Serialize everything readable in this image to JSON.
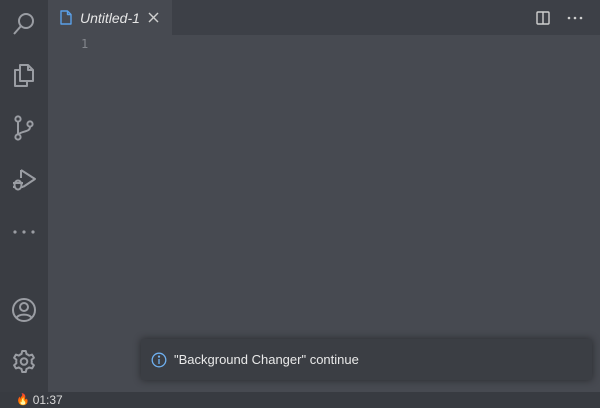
{
  "activity_bar": {
    "icons": [
      "search-icon",
      "explorer-icon",
      "source-control-icon",
      "run-debug-icon",
      "more-icon",
      "account-icon",
      "settings-icon"
    ]
  },
  "tab": {
    "label": "Untitled-1",
    "file_icon": "file-icon",
    "close_icon": "close-icon"
  },
  "tab_actions": {
    "icons": [
      "split-editor-icon",
      "more-actions-icon"
    ]
  },
  "editor": {
    "line_numbers": [
      "1"
    ]
  },
  "notification": {
    "icon": "info-icon",
    "message": "\"Background Changer\" continue"
  },
  "status_bar": {
    "timer_icon": "flame-icon",
    "timer": "01:37"
  },
  "colors": {
    "editor_bg": "#474a51",
    "activity_bar_bg": "#3a3d43",
    "icon": "#9a9da3",
    "accent": "#5aa0e8"
  }
}
